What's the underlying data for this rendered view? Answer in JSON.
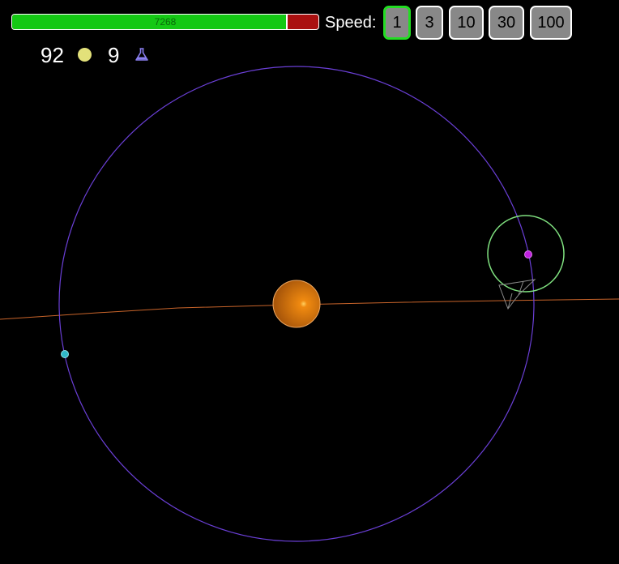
{
  "hud": {
    "fuel": {
      "value_label": "7268",
      "fill_fraction": 0.9,
      "fill_color": "#14c814",
      "empty_color": "#aa1010"
    },
    "speed_label": "Speed:",
    "speed_options": [
      {
        "label": "1",
        "active": true
      },
      {
        "label": "3",
        "active": false
      },
      {
        "label": "10",
        "active": false
      },
      {
        "label": "30",
        "active": false
      },
      {
        "label": "100",
        "active": false
      }
    ],
    "coins": {
      "count": "92",
      "icon": "coin-icon",
      "color": "#e3e17a"
    },
    "science": {
      "count": "9",
      "icon": "flask-icon",
      "color": "#8a7ff0"
    }
  },
  "scene": {
    "background": "#000000",
    "colors": {
      "orbit": "#6a3fd6",
      "trajectory": "#c8642a",
      "sun": "#e07a10",
      "target_ring": "#7fe07f",
      "planet_magenta": "#c020e0",
      "planet_cyan": "#30b8c8",
      "ship": "#888888"
    }
  }
}
